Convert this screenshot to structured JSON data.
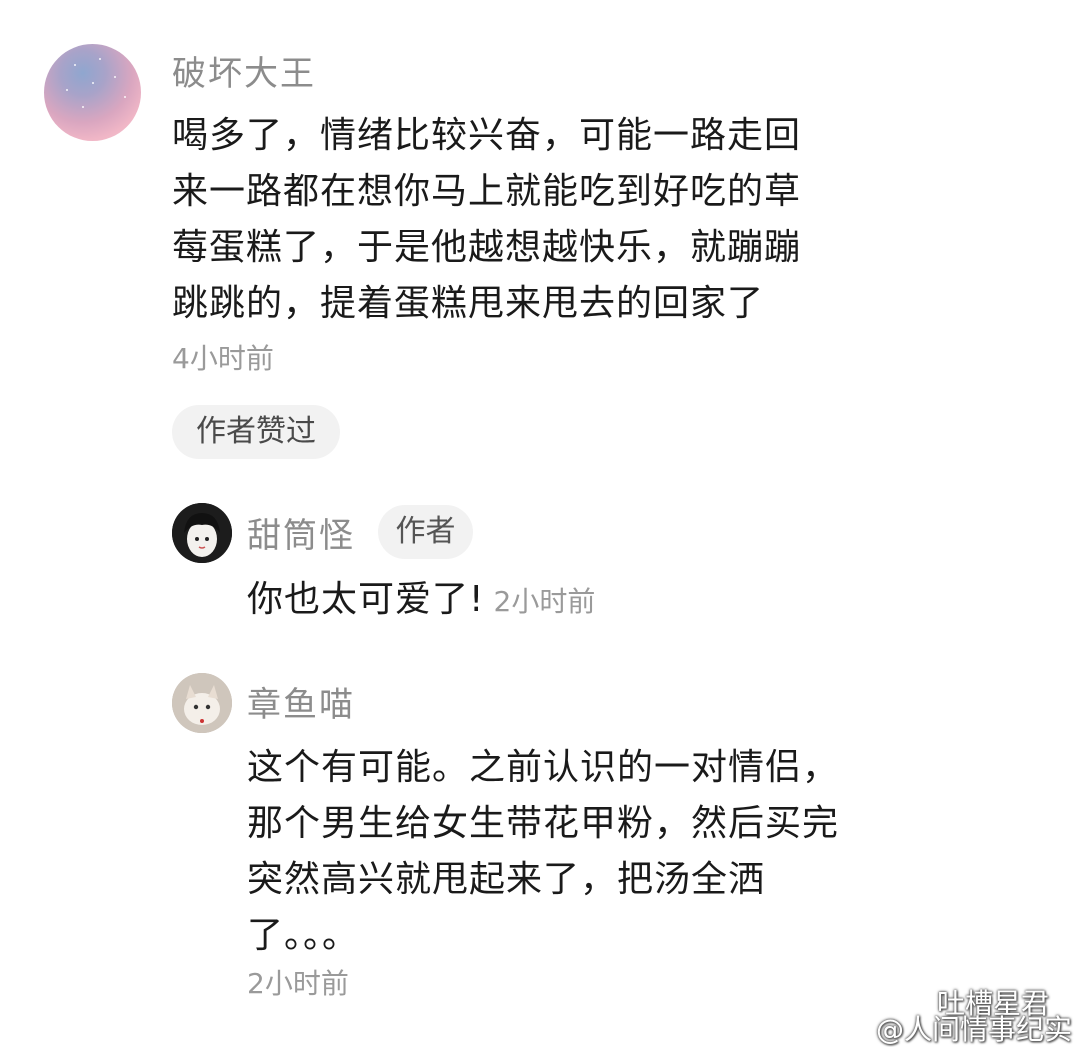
{
  "comment": {
    "username": "破坏大王",
    "lines": [
      "喝多了，情绪比较兴奋，可能一路走回",
      "来一路都在想你马上就能吃到好吃的草",
      "莓蛋糕了，于是他越想越快乐，就蹦蹦",
      "跳跳的，提着蛋糕甩来甩去的回家了"
    ],
    "time": "4小时前",
    "liked_badge": "作者赞过"
  },
  "replies": [
    {
      "username": "甜筒怪",
      "role_badge": "作者",
      "text": "你也太可爱了!",
      "time": "2小时前"
    },
    {
      "username": "章鱼喵",
      "lines": [
        "这个有可能。之前认识的一对情侣，",
        "那个男生给女生带花甲粉，然后买完",
        "突然高兴就甩起来了，把汤全洒",
        "了。。。"
      ],
      "time": "2小时前"
    }
  ],
  "watermark": {
    "wechat_account": "吐槽星君",
    "weibo_account": "@人间情事纪实",
    "icons": [
      "wechat-icon",
      "weibo-icon"
    ]
  }
}
